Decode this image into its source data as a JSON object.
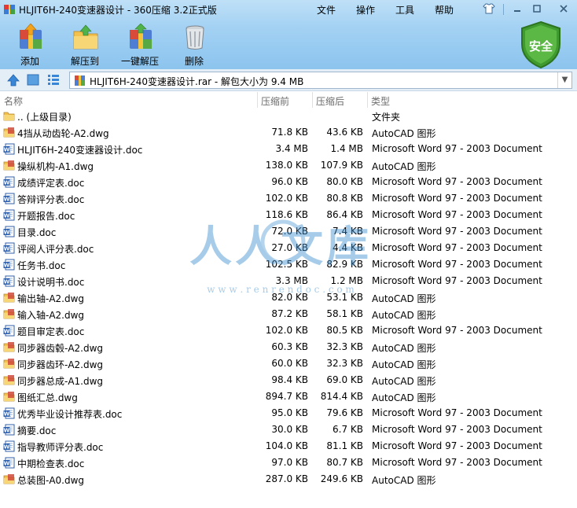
{
  "window": {
    "title": "HLJIT6H-240变速器设计 - 360压缩 3.2正式版",
    "menus": [
      "文件",
      "操作",
      "工具",
      "帮助"
    ]
  },
  "toolbar": {
    "add": "添加",
    "extract": "解压到",
    "onekey": "一键解压",
    "delete": "删除"
  },
  "security_badge": "安全",
  "address": {
    "path": "HLJIT6H-240变速器设计.rar - 解包大小为 9.4 MB"
  },
  "columns": {
    "name": "名称",
    "original": "压缩前",
    "compressed": "压缩后",
    "type": "类型"
  },
  "files": [
    {
      "name": ".. (上级目录)",
      "original": "",
      "compressed": "",
      "type": "文件夹",
      "icon": "folder"
    },
    {
      "name": "4挡从动齿轮-A2.dwg",
      "original": "71.8 KB",
      "compressed": "43.6 KB",
      "type": "AutoCAD 图形",
      "icon": "dwg"
    },
    {
      "name": "HLJIT6H-240变速器设计.doc",
      "original": "3.4 MB",
      "compressed": "1.4 MB",
      "type": "Microsoft Word 97 - 2003 Document",
      "icon": "doc"
    },
    {
      "name": "操纵机构-A1.dwg",
      "original": "138.0 KB",
      "compressed": "107.9 KB",
      "type": "AutoCAD 图形",
      "icon": "dwg"
    },
    {
      "name": "成绩评定表.doc",
      "original": "96.0 KB",
      "compressed": "80.0 KB",
      "type": "Microsoft Word 97 - 2003 Document",
      "icon": "doc"
    },
    {
      "name": "答辩评分表.doc",
      "original": "102.0 KB",
      "compressed": "80.8 KB",
      "type": "Microsoft Word 97 - 2003 Document",
      "icon": "doc"
    },
    {
      "name": "开题报告.doc",
      "original": "118.6 KB",
      "compressed": "86.4 KB",
      "type": "Microsoft Word 97 - 2003 Document",
      "icon": "doc"
    },
    {
      "name": "目录.doc",
      "original": "72.0 KB",
      "compressed": "7.4 KB",
      "type": "Microsoft Word 97 - 2003 Document",
      "icon": "doc"
    },
    {
      "name": "评阅人评分表.doc",
      "original": "27.0 KB",
      "compressed": "4.4 KB",
      "type": "Microsoft Word 97 - 2003 Document",
      "icon": "doc"
    },
    {
      "name": "任务书.doc",
      "original": "102.5 KB",
      "compressed": "82.9 KB",
      "type": "Microsoft Word 97 - 2003 Document",
      "icon": "doc"
    },
    {
      "name": "设计说明书.doc",
      "original": "3.3 MB",
      "compressed": "1.2 MB",
      "type": "Microsoft Word 97 - 2003 Document",
      "icon": "doc"
    },
    {
      "name": "输出轴-A2.dwg",
      "original": "82.0 KB",
      "compressed": "53.1 KB",
      "type": "AutoCAD 图形",
      "icon": "dwg"
    },
    {
      "name": "输入轴-A2.dwg",
      "original": "87.2 KB",
      "compressed": "58.1 KB",
      "type": "AutoCAD 图形",
      "icon": "dwg"
    },
    {
      "name": "题目审定表.doc",
      "original": "102.0 KB",
      "compressed": "80.5 KB",
      "type": "Microsoft Word 97 - 2003 Document",
      "icon": "doc"
    },
    {
      "name": "同步器齿毂-A2.dwg",
      "original": "60.3 KB",
      "compressed": "32.3 KB",
      "type": "AutoCAD 图形",
      "icon": "dwg"
    },
    {
      "name": "同步器齿环-A2.dwg",
      "original": "60.0 KB",
      "compressed": "32.3 KB",
      "type": "AutoCAD 图形",
      "icon": "dwg"
    },
    {
      "name": "同步器总成-A1.dwg",
      "original": "98.4 KB",
      "compressed": "69.0 KB",
      "type": "AutoCAD 图形",
      "icon": "dwg"
    },
    {
      "name": "图纸汇总.dwg",
      "original": "894.7 KB",
      "compressed": "814.4 KB",
      "type": "AutoCAD 图形",
      "icon": "dwg"
    },
    {
      "name": "优秀毕业设计推荐表.doc",
      "original": "95.0 KB",
      "compressed": "79.6 KB",
      "type": "Microsoft Word 97 - 2003 Document",
      "icon": "doc"
    },
    {
      "name": "摘要.doc",
      "original": "30.0 KB",
      "compressed": "6.7 KB",
      "type": "Microsoft Word 97 - 2003 Document",
      "icon": "doc"
    },
    {
      "name": "指导教师评分表.doc",
      "original": "104.0 KB",
      "compressed": "81.1 KB",
      "type": "Microsoft Word 97 - 2003 Document",
      "icon": "doc"
    },
    {
      "name": "中期检查表.doc",
      "original": "97.0 KB",
      "compressed": "80.7 KB",
      "type": "Microsoft Word 97 - 2003 Document",
      "icon": "doc"
    },
    {
      "name": "总装图-A0.dwg",
      "original": "287.0 KB",
      "compressed": "249.6 KB",
      "type": "AutoCAD 图形",
      "icon": "dwg"
    }
  ],
  "watermark": {
    "text": "人人文库",
    "url": "w w w . r e n r e n d o c . c o m"
  }
}
